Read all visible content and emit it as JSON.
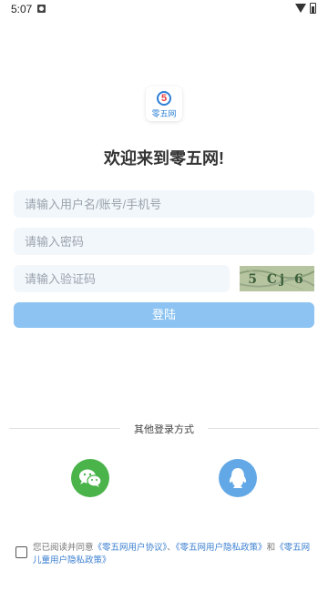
{
  "status_bar": {
    "time": "5:07"
  },
  "logo": {
    "circle_text": "5",
    "text": "零五网"
  },
  "welcome": "欢迎来到零五网!",
  "form": {
    "username_placeholder": "请输入用户名/账号/手机号",
    "password_placeholder": "请输入密码",
    "captcha_placeholder": "请输入验证码",
    "captcha_text": "5 Cj 6",
    "login_label": "登陆"
  },
  "other_login": {
    "title": "其他登录方式",
    "options": [
      "wechat",
      "qq"
    ]
  },
  "agreement": {
    "prefix": "您已阅读并同意",
    "link1": "《零五网用户协议》",
    "sep": "、",
    "link2": "《零五网用户隐私政策》",
    "and": "和",
    "link3": "《零五网儿童用户隐私政策》"
  },
  "colors": {
    "primary": "#8cc3f2",
    "field_bg": "#f2f7fc",
    "wechat": "#4ab34a",
    "qq": "#63a8e6",
    "link": "#3b7fd0"
  }
}
